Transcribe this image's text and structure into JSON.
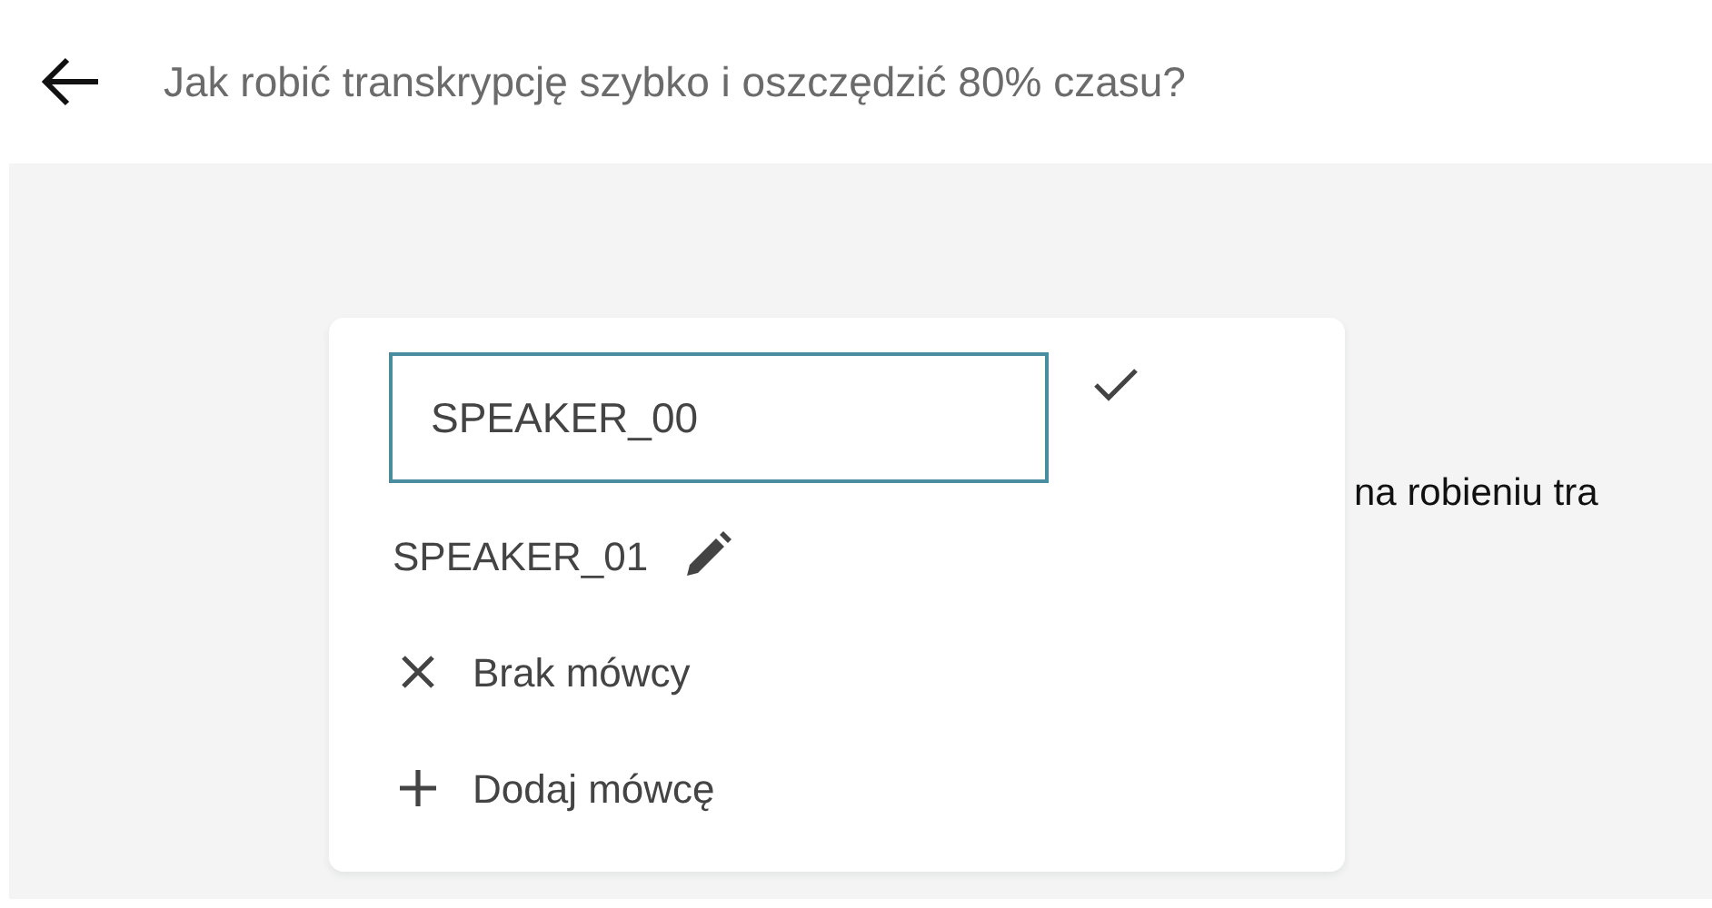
{
  "header": {
    "title": "Jak robić transkrypcję szybko i oszczędzić 80% czasu?"
  },
  "background_text": "na robieniu tra",
  "speaker_menu": {
    "editing": {
      "value": "SPEAKER_00"
    },
    "items": [
      {
        "kind": "speaker",
        "label": "SPEAKER_01"
      },
      {
        "kind": "none",
        "label": "Brak mówcy"
      },
      {
        "kind": "add",
        "label": "Dodaj mówcę"
      }
    ]
  }
}
